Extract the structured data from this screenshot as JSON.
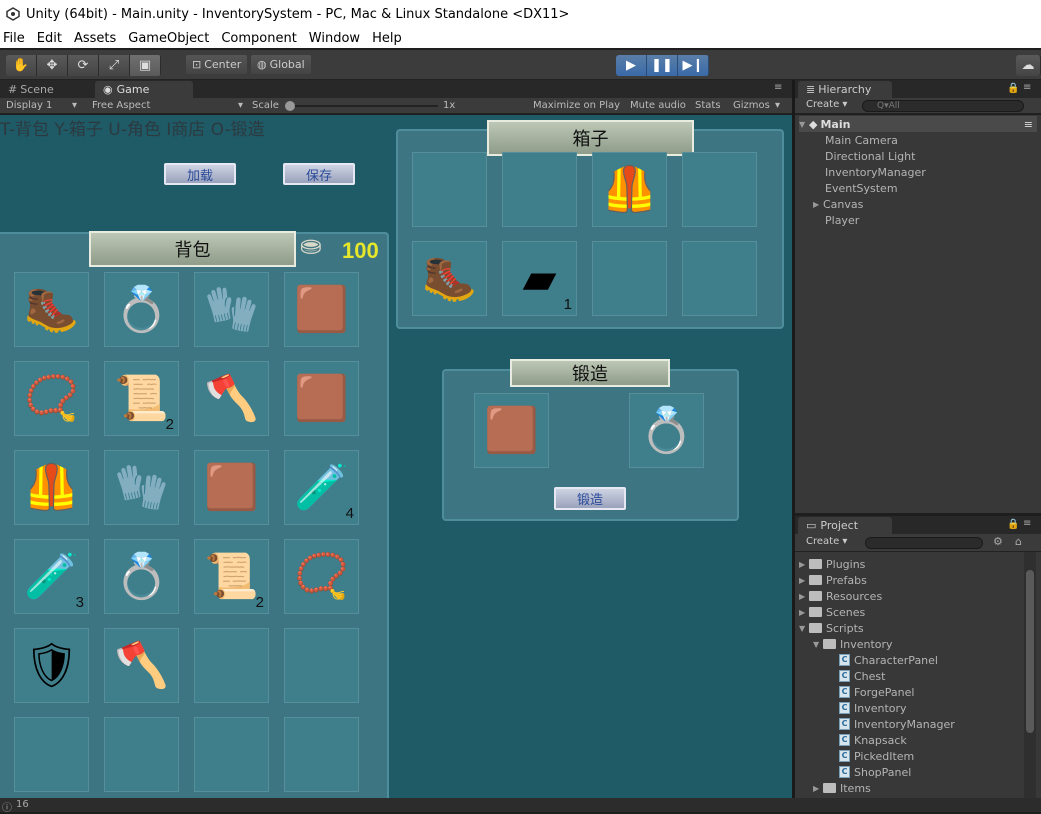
{
  "window": {
    "title": "Unity (64bit) - Main.unity - InventorySystem - PC, Mac & Linux Standalone <DX11>"
  },
  "menu": [
    "File",
    "Edit",
    "Assets",
    "GameObject",
    "Component",
    "Window",
    "Help"
  ],
  "toolbar": {
    "tools": [
      "hand",
      "move",
      "rotate",
      "scale",
      "rect"
    ],
    "pivot_center": "Center",
    "pivot_global": "Global"
  },
  "tabs": {
    "scene": "Scene",
    "game": "Game"
  },
  "gamebar": {
    "display": "Display 1",
    "aspect": "Free Aspect",
    "scale_label": "Scale",
    "scale_value": "1x",
    "maximize": "Maximize on Play",
    "mute": "Mute audio",
    "stats": "Stats",
    "gizmos": "Gizmos"
  },
  "game": {
    "hint": "T-背包 Y-箱子 U-角色 I商店 O-锻造",
    "load_button": "加载",
    "save_button": "保存",
    "knapsack_title": "背包",
    "coins": "100",
    "chest_title": "箱子",
    "forge_title": "锻造",
    "forge_button": "锻造",
    "knapsack_slots": [
      {
        "item": "boots-icon",
        "count": ""
      },
      {
        "item": "ring-icon",
        "count": ""
      },
      {
        "item": "glove-icon",
        "count": ""
      },
      {
        "item": "belt-icon",
        "count": ""
      },
      {
        "item": "necklace-icon",
        "count": ""
      },
      {
        "item": "scroll-icon",
        "count": "2"
      },
      {
        "item": "axe-icon",
        "count": ""
      },
      {
        "item": "belt-icon",
        "count": ""
      },
      {
        "item": "armor-icon",
        "count": ""
      },
      {
        "item": "glove-icon",
        "count": ""
      },
      {
        "item": "belt-icon",
        "count": ""
      },
      {
        "item": "red-potion-icon",
        "count": "4"
      },
      {
        "item": "blue-potion-icon",
        "count": "3"
      },
      {
        "item": "ring-icon",
        "count": ""
      },
      {
        "item": "scroll-icon",
        "count": "2"
      },
      {
        "item": "necklace-icon",
        "count": ""
      },
      {
        "item": "shoulder-icon",
        "count": ""
      },
      {
        "item": "axe-icon",
        "count": ""
      },
      {
        "item": "",
        "count": ""
      },
      {
        "item": "",
        "count": ""
      },
      {
        "item": "",
        "count": ""
      },
      {
        "item": "",
        "count": ""
      },
      {
        "item": "",
        "count": ""
      },
      {
        "item": "",
        "count": ""
      }
    ],
    "chest_slots": [
      {
        "item": "",
        "count": ""
      },
      {
        "item": "",
        "count": ""
      },
      {
        "item": "armor-icon",
        "count": ""
      },
      {
        "item": "",
        "count": ""
      },
      {
        "item": "boots-icon",
        "count": ""
      },
      {
        "item": "iron-ingot-icon",
        "count": "1"
      },
      {
        "item": "",
        "count": ""
      },
      {
        "item": "",
        "count": ""
      }
    ],
    "forge_slots": [
      {
        "item": "belt-icon",
        "count": ""
      },
      {
        "item": "ring-icon",
        "count": ""
      }
    ]
  },
  "hierarchy": {
    "tab": "Hierarchy",
    "create": "Create",
    "search_placeholder": "Q▾All",
    "scene": "Main",
    "items": [
      "Main Camera",
      "Directional Light",
      "InventoryManager",
      "EventSystem",
      "Canvas",
      "Player"
    ]
  },
  "project": {
    "tab": "Project",
    "create": "Create",
    "folders": [
      "Plugins",
      "Prefabs",
      "Resources",
      "Scenes",
      "Scripts"
    ],
    "subfolder": "Inventory",
    "scripts": [
      "CharacterPanel",
      "Chest",
      "ForgePanel",
      "Inventory",
      "InventoryManager",
      "Knapsack",
      "PickedItem",
      "ShopPanel"
    ],
    "more_folder": "Items"
  },
  "status": {
    "count": "16"
  },
  "icons": {
    "boots-icon": "🥾",
    "ring-icon": "💍",
    "glove-icon": "🧤",
    "belt-icon": "🟫",
    "necklace-icon": "📿",
    "scroll-icon": "📜",
    "axe-icon": "🪓",
    "armor-icon": "🦺",
    "red-potion-icon": "🧪",
    "blue-potion-icon": "🧪",
    "shoulder-icon": "🛡",
    "iron-ingot-icon": "▰"
  }
}
